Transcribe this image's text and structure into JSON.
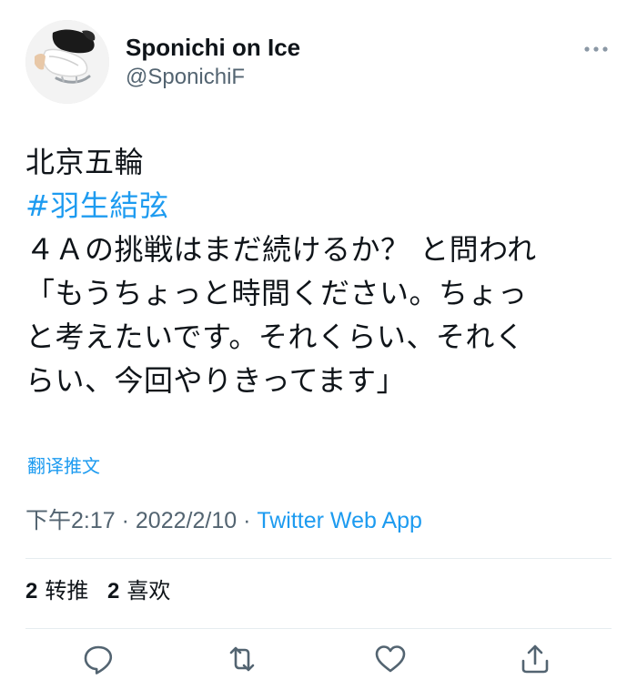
{
  "tweet": {
    "author": {
      "display_name": "Sponichi on Ice",
      "handle": "@SponichiF",
      "avatar_icon": "ice-skate-avatar"
    },
    "more_icon": "more-horizontal-icon",
    "text_lines": [
      "北京五輪",
      "#羽生結弦",
      "４Ａの挑戦はまだ続けるか？ と問われ",
      "「もうちょっと時間ください。ちょっ",
      "と考えたいです。それくらい、それく",
      "らい、今回やりきってます」"
    ],
    "translate_label": "翻译推文",
    "time": "下午2:17",
    "date": "2022/2/10",
    "separator": "·",
    "source_app": "Twitter Web App",
    "stats": {
      "retweets_count": "2",
      "retweets_label": "转推",
      "likes_count": "2",
      "likes_label": "喜欢"
    }
  },
  "actions": [
    "reply-icon",
    "retweet-icon",
    "like-icon",
    "share-icon"
  ],
  "colors": {
    "accent": "#1d9bf0",
    "text": "#0f1419",
    "secondary": "#536471",
    "divider": "#e6ecf0"
  }
}
